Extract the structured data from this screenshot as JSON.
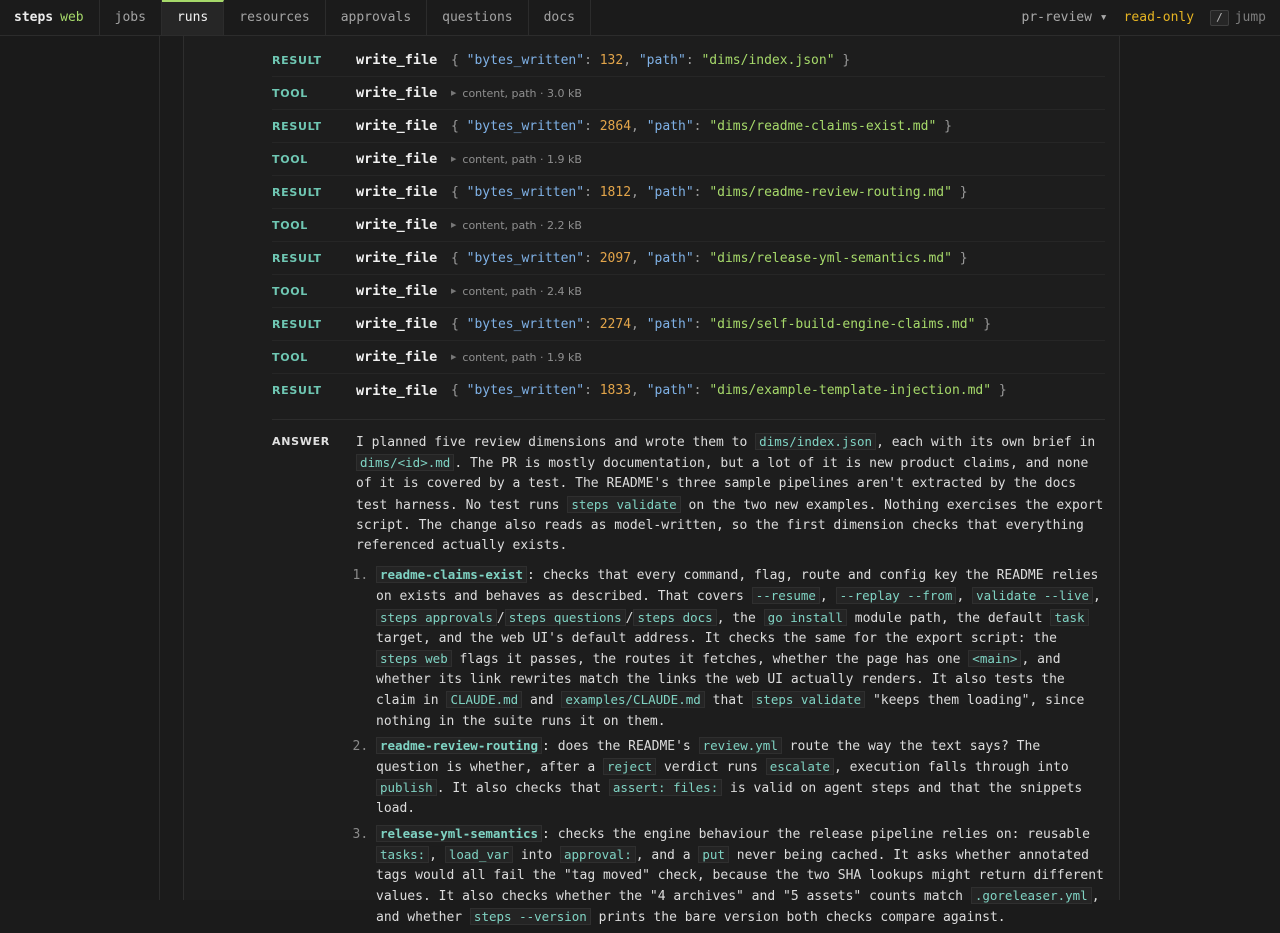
{
  "nav": {
    "brand": "steps",
    "brand_sub": "web",
    "tabs": [
      "jobs",
      "runs",
      "resources",
      "approvals",
      "questions",
      "docs"
    ],
    "project": "pr-review ▾",
    "mode": "read-only",
    "jump_key": "/",
    "jump_label": "jump"
  },
  "labels": {
    "result": "RESULT",
    "tool": "TOOL",
    "answer": "ANSWER"
  },
  "rows": [
    {
      "fn": "write_file",
      "bytes": "132",
      "path": "\"dims/index.json\""
    },
    {
      "fn": "write_file",
      "args": "content, path · 3.0 kB"
    },
    {
      "fn": "write_file",
      "bytes": "2864",
      "path": "\"dims/readme-claims-exist.md\""
    },
    {
      "fn": "write_file",
      "args": "content, path · 1.9 kB"
    },
    {
      "fn": "write_file",
      "bytes": "1812",
      "path": "\"dims/readme-review-routing.md\""
    },
    {
      "fn": "write_file",
      "args": "content, path · 2.2 kB"
    },
    {
      "fn": "write_file",
      "bytes": "2097",
      "path": "\"dims/release-yml-semantics.md\""
    },
    {
      "fn": "write_file",
      "args": "content, path · 2.4 kB"
    },
    {
      "fn": "write_file",
      "bytes": "2274",
      "path": "\"dims/self-build-engine-claims.md\""
    },
    {
      "fn": "write_file",
      "args": "content, path · 1.9 kB"
    },
    {
      "fn": "write_file",
      "bytes": "1833",
      "path": "\"dims/example-template-injection.md\""
    }
  ],
  "json_keys": {
    "bytes": "\"bytes_written\"",
    "path": "\"path\""
  },
  "answer": {
    "intro": [
      "I planned five review dimensions and wrote them to ",
      "dims/index.json",
      ", each with its own brief in ",
      "dims/<id>.md",
      ". The PR is mostly documentation, but a lot of it is new product claims, and none of it is covered by a test. The README's three sample pipelines aren't extracted by the docs test harness. No test runs ",
      "steps validate",
      " on the two new examples. Nothing exercises the export script. The change also reads as model-written, so the first dimension checks that everything referenced actually exists."
    ],
    "items": [
      [
        "readme-claims-exist",
        ": checks that every command, flag, route and config key the README relies on exists and behaves as described. That covers ",
        "--resume",
        ", ",
        "--replay --from",
        ", ",
        "validate --live",
        ", ",
        "steps approvals",
        "/",
        "steps questions",
        "/",
        "steps docs",
        ", the ",
        "go install",
        " module path, the default ",
        "task",
        " target, and the web UI's default address. It checks the same for the export script: the ",
        "steps web",
        " flags it passes, the routes it fetches, whether the page has one ",
        "<main>",
        ", and whether its link rewrites match the links the web UI actually renders. It also tests the claim in ",
        "CLAUDE.md",
        " and ",
        "examples/CLAUDE.md",
        " that ",
        "steps validate",
        " \"keeps them loading\", since nothing in the suite runs it on them."
      ],
      [
        "readme-review-routing",
        ": does the README's ",
        "review.yml",
        " route the way the text says? The question is whether, after a ",
        "reject",
        " verdict runs ",
        "escalate",
        ", execution falls through into ",
        "publish",
        ". It also checks that ",
        "assert: files:",
        " is valid on agent steps and that the snippets load."
      ],
      [
        "release-yml-semantics",
        ": checks the engine behaviour the release pipeline relies on: reusable ",
        "tasks:",
        ", ",
        "load_var",
        " into ",
        "approval:",
        ", and a ",
        "put",
        " never being cached. It asks whether annotated tags would all fail the \"tag moved\" check, because the two SHA lookups might return different values. It also checks whether the \"4 archives\" and \"5 assets\" counts match ",
        ".goreleaser.yml",
        ", and whether ",
        "steps --version",
        " prints the bare version both checks compare against."
      ]
    ]
  }
}
